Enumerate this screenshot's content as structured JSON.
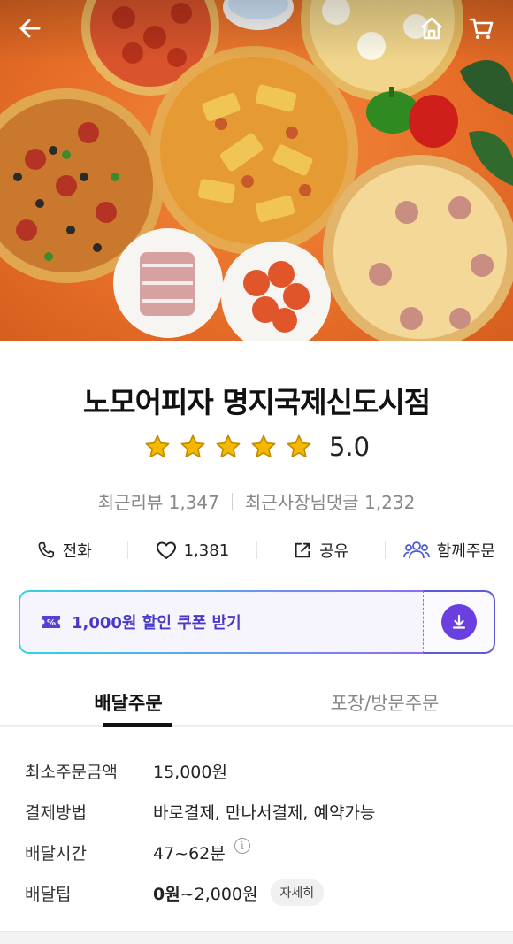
{
  "store": {
    "name": "노모어피자 명지국제신도시점",
    "rating": 5,
    "rating_label": "5.0",
    "recent_reviews": "최근리뷰 1,347",
    "owner_replies": "최근사장님댓글 1,232"
  },
  "actions": {
    "call": "전화",
    "likes": "1,381",
    "share": "공유",
    "group_order": "함께주문"
  },
  "coupon": {
    "text": "1,000원 할인 쿠폰 받기"
  },
  "tabs": [
    {
      "label": "배달주문",
      "active": true
    },
    {
      "label": "포장/방문주문",
      "active": false
    }
  ],
  "info": {
    "min_order_key": "최소주문금액",
    "min_order_val": "15,000원",
    "payment_key": "결제방법",
    "payment_val": "바로결제, 만나서결제, 예약가능",
    "time_key": "배달시간",
    "time_val": "47~62분",
    "tip_key": "배달팁",
    "tip_min": "0원",
    "tip_rest": "~2,000원",
    "detail_label": "자세히"
  },
  "colors": {
    "accent_purple": "#6a3fe0",
    "coupon_text": "#4a38c9",
    "star": "#f5b800"
  },
  "icons": [
    "back-arrow-icon",
    "home-icon",
    "cart-icon",
    "star-icon",
    "phone-icon",
    "heart-icon",
    "share-icon",
    "group-icon",
    "coupon-icon",
    "download-icon",
    "info-icon"
  ]
}
